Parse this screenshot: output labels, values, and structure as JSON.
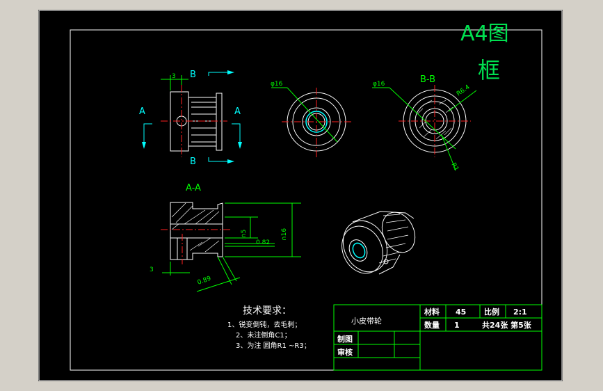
{
  "frame_title_line1": "A4图",
  "frame_title_line2": "框",
  "views": {
    "front": {
      "section_a": "A",
      "section_b": "B",
      "dim_3": "3"
    },
    "end_view": {
      "dia": "φ16"
    },
    "section_bb": {
      "title": "B-B",
      "dia": "φ16",
      "r_outer": "R6.4",
      "r_inner": "R1"
    },
    "section_aa": {
      "title": "A-A",
      "dim_3": "3",
      "dim_089": "0.89",
      "dim_n5": "∩5",
      "dim_082": "0.82",
      "dim_n16": "∩16"
    }
  },
  "notes": {
    "title": "技术要求：",
    "lines": [
      "1、锐变倒钝，去毛刺；",
      "2、未注倒角C1；",
      "3、为注 圆角R1 ~R3；"
    ]
  },
  "title_block": {
    "part_name": "小皮带轮",
    "material_label": "材料",
    "material_value": "45",
    "scale_label": "比例",
    "scale_value": "2:1",
    "qty_label": "数量",
    "qty_value": "1",
    "sheets_text": "共24张  第5张",
    "drawn_label": "制图",
    "checked_label": "审核"
  },
  "colors": {
    "background": "#000000",
    "border": "#ffffff",
    "frame_title": "#00e050",
    "dimension": "#00ff00",
    "section_arrow": "#00ffff",
    "centerline": "#ff2020",
    "outline": "#ffffff"
  }
}
